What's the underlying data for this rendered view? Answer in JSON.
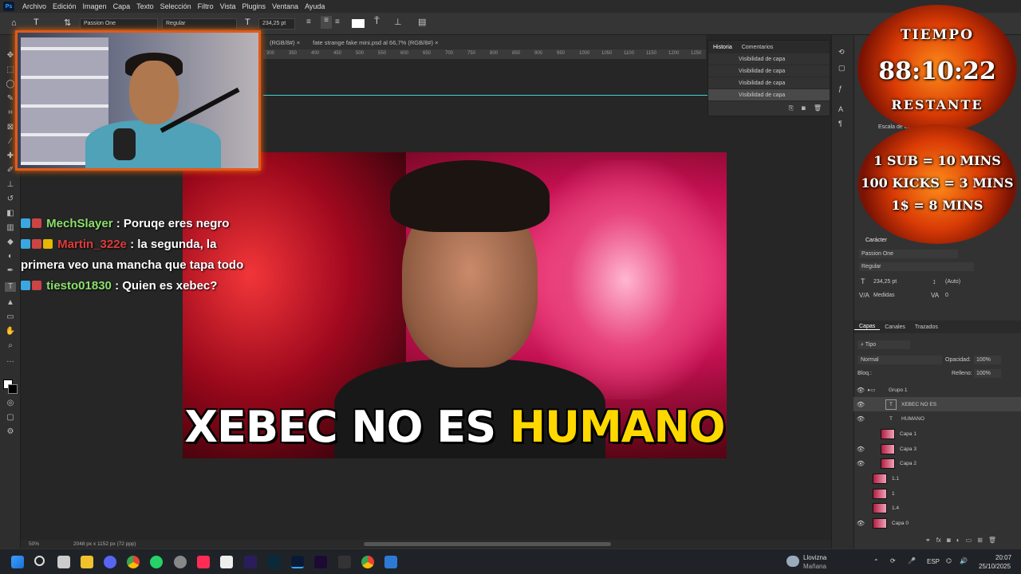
{
  "menu": [
    "Archivo",
    "Edición",
    "Imagen",
    "Capa",
    "Texto",
    "Selección",
    "Filtro",
    "Vista",
    "Plugins",
    "Ventana",
    "Ayuda"
  ],
  "ps_logo": "Ps",
  "options": {
    "font_family": "Passion One",
    "font_style": "Regular",
    "font_size": "234,25 pt"
  },
  "doc_tabs": [
    "(RGB/8#) ×",
    "fate strange fake mini.psd al 66,7% (RGB/8#) ×"
  ],
  "ruler_marks": [
    "300",
    "350",
    "400",
    "450",
    "500",
    "550",
    "600",
    "650",
    "700",
    "750",
    "800",
    "850",
    "900",
    "950",
    "1000",
    "1050",
    "1100",
    "1150",
    "1200",
    "1250"
  ],
  "thumbnail": {
    "title_white": "XEBEC NO ES",
    "title_yellow": "HUMANO"
  },
  "chat": [
    {
      "user": "MechSlayer",
      "message": ": Poruqe eres negro"
    },
    {
      "user": "Martin_322e",
      "message": ": la segunda, la primera veo una mancha que tapa todo"
    },
    {
      "user": "tiesto01830",
      "message": ": Quien es xebec?"
    }
  ],
  "history": {
    "tabs": [
      "Historia",
      "Comentarios"
    ],
    "rows": [
      "Visibilidad de capa",
      "Visibilidad de capa",
      "Visibilidad de capa",
      "Visibilidad de capa"
    ]
  },
  "timer": {
    "label_top": "TIEMPO",
    "time": "88:10:22",
    "label_bottom": "RESTANTE",
    "rule1": "1 SUB = 10 MINS",
    "rule2": "100 KICKS = 3 MINS",
    "rule3": "1$ = 8 MINS"
  },
  "properties": {
    "scale_label": "Escala de eses",
    "character_title": "Carácter",
    "font_family": "Passion One",
    "font_style": "Regular",
    "size": "234,25 pt",
    "leading": "(Auto)",
    "kerning": "Medidas",
    "tracking": "0"
  },
  "layers_panel": {
    "tabs": [
      "Capas",
      "Canales",
      "Trazados"
    ],
    "filter": "Tipo",
    "blend": "Normal",
    "opacity_label": "Opacidad:",
    "opacity": "100%",
    "lock_label": "Bloq.:",
    "fill_label": "Relleno:",
    "fill": "100%",
    "layers": [
      {
        "name": "Grupo 1",
        "visible": true,
        "kind": "group"
      },
      {
        "name": "XEBEC NO ES",
        "visible": true,
        "kind": "text"
      },
      {
        "name": "HUMANO",
        "visible": true,
        "kind": "text"
      },
      {
        "name": "Capa 1",
        "visible": false,
        "kind": "image"
      },
      {
        "name": "Capa 3",
        "visible": true,
        "kind": "image"
      },
      {
        "name": "Capa 2",
        "visible": true,
        "kind": "image"
      },
      {
        "name": "1.1",
        "visible": false,
        "kind": "image"
      },
      {
        "name": "1",
        "visible": false,
        "kind": "image"
      },
      {
        "name": "1.4",
        "visible": false,
        "kind": "image"
      },
      {
        "name": "Capa 0",
        "visible": true,
        "kind": "image"
      }
    ]
  },
  "status": {
    "zoom": "50%",
    "doc_info": "2048 px x 1152 px (72 ppp)"
  },
  "taskbar": {
    "weather_title": "Llovizna",
    "weather_sub": "Mañana",
    "lang": "ESP",
    "time": "20:07",
    "date": "25/10/2025"
  }
}
